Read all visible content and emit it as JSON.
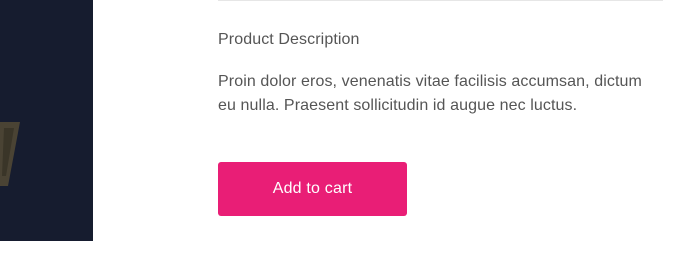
{
  "product": {
    "description_heading": "Product Description",
    "description_text": "Proin dolor eros, venenatis vitae facilisis accumsan, dictum eu nulla. Praesent sollicitudin id augue nec luctus.",
    "add_to_cart_label": "Add to cart"
  },
  "colors": {
    "image_background": "#161c2f",
    "accent_button": "#e91e76",
    "body_text": "#555555",
    "divider": "#e6e6e6"
  }
}
